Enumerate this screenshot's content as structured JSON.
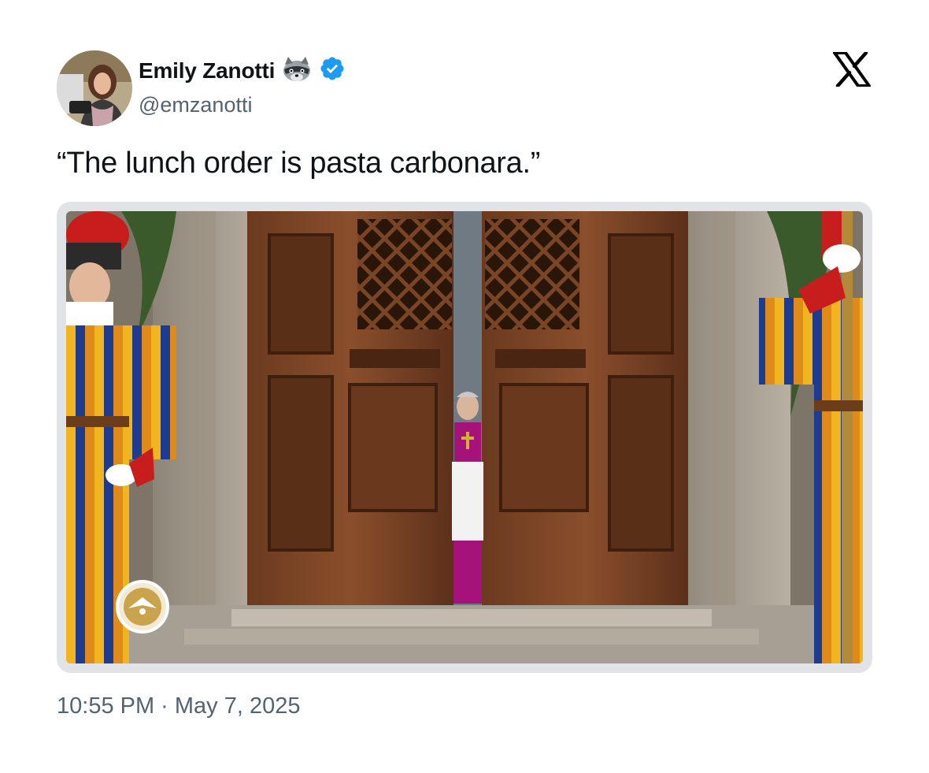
{
  "author": {
    "name": "Emily Zanotti",
    "handle": "@emzanotti",
    "badge_emoji": "raccoon-icon",
    "verified": true,
    "verified_color": "#1d9bf0"
  },
  "tweet": {
    "text": "“The lunch order is pasta carbonara.”",
    "timestamp": "10:55 PM · May 7, 2025"
  },
  "media": {
    "description_icon": "vatican-video-still",
    "watermark_icon": "dove-seal-icon"
  },
  "platform": {
    "logo": "x-logo-icon"
  }
}
